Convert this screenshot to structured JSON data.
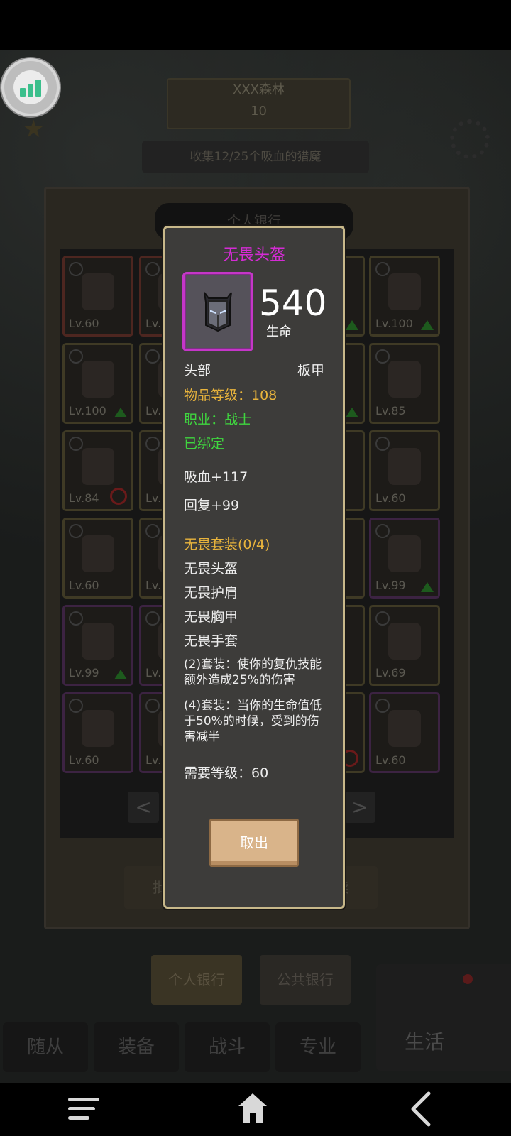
{
  "background": {
    "location_name": "XXX森林",
    "location_level": "10",
    "quest": "收集12/25个吸血的猎魔",
    "bank_title": "个人银行",
    "slots": [
      {
        "lv": "Lv.60",
        "mark": ""
      },
      {
        "lv": "Lv.",
        "mark": ""
      },
      {
        "lv": "",
        "mark": "up"
      },
      {
        "lv": "Lv.100",
        "mark": "up"
      },
      {
        "lv": "Lv.100",
        "mark": "up"
      },
      {
        "lv": "Lv.",
        "mark": ""
      },
      {
        "lv": "",
        "mark": "up"
      },
      {
        "lv": "Lv.85",
        "mark": ""
      },
      {
        "lv": "Lv.84",
        "mark": "ban"
      },
      {
        "lv": "Lv.",
        "mark": ""
      },
      {
        "lv": "",
        "mark": ""
      },
      {
        "lv": "Lv.60",
        "mark": ""
      },
      {
        "lv": "Lv.60",
        "mark": ""
      },
      {
        "lv": "Lv.",
        "mark": ""
      },
      {
        "lv": "",
        "mark": ""
      },
      {
        "lv": "Lv.99",
        "mark": "up"
      },
      {
        "lv": "Lv.99",
        "mark": "up"
      },
      {
        "lv": "Lv.",
        "mark": ""
      },
      {
        "lv": "",
        "mark": ""
      },
      {
        "lv": "Lv.69",
        "mark": ""
      },
      {
        "lv": "Lv.60",
        "mark": ""
      },
      {
        "lv": "Lv.",
        "mark": ""
      },
      {
        "lv": "",
        "mark": "ban"
      },
      {
        "lv": "Lv.60",
        "mark": ""
      }
    ],
    "prev_label": "<",
    "next_label": ">",
    "bulk_left": "批量",
    "bulk_right": "出卖",
    "tab_personal": "个人银行",
    "tab_public": "公共银行",
    "nav": [
      "随从",
      "装备",
      "战斗",
      "专业"
    ],
    "home_label": "生活"
  },
  "item_tooltip": {
    "name": "无畏头盔",
    "stat_value": "540",
    "stat_name": "生命",
    "slot": "头部",
    "armor_type": "板甲",
    "item_level": "物品等级：108",
    "class_req": "职业：战士",
    "bound": "已绑定",
    "bonus_1": "吸血+117",
    "bonus_2": "回复+99",
    "set_name": "无畏套装(0/4)",
    "set_items": [
      "无畏头盔",
      "无畏护肩",
      "无畏胸甲",
      "无畏手套"
    ],
    "set_bonus_2": "(2)套装：使你的复仇技能额外造成25%的伤害",
    "set_bonus_4": "(4)套装：当你的生命值低于50%的时候，受到的伤害减半",
    "required_level": "需要等级：60",
    "cancel_label": "取出"
  },
  "colors": {
    "epic_purple": "#d52bd5",
    "gold": "#e9b43c",
    "green": "#3fd53f",
    "modal_bg": "#3d3c3a",
    "modal_border": "#c8b88a",
    "button": "#d9b48a"
  }
}
